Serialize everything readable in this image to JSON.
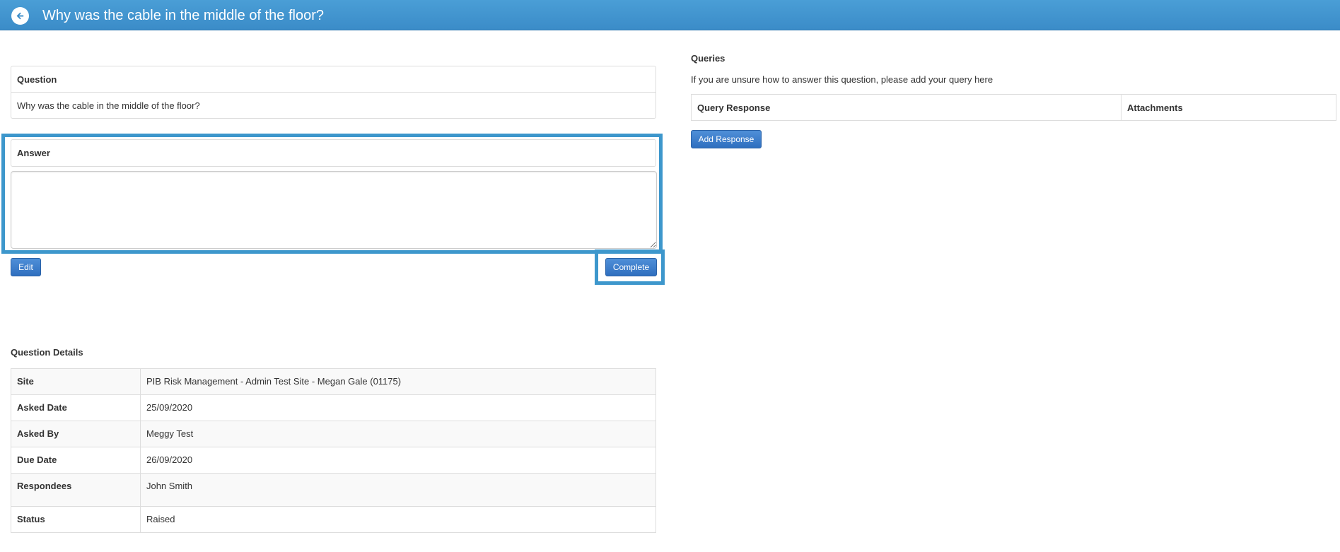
{
  "header": {
    "title": "Why was the cable in the middle of the floor?",
    "back_icon": "arrow-left-circle-icon"
  },
  "question": {
    "heading": "Question",
    "text": "Why was the cable in the middle of the floor?"
  },
  "answer": {
    "heading": "Answer",
    "value": "",
    "placeholder": ""
  },
  "buttons": {
    "edit": "Edit",
    "complete": "Complete",
    "add_response": "Add Response"
  },
  "details": {
    "title": "Question Details",
    "rows": [
      {
        "label": "Site",
        "value": "PIB Risk Management - Admin Test Site - Megan Gale (01175)"
      },
      {
        "label": "Asked Date",
        "value": "25/09/2020"
      },
      {
        "label": "Asked By",
        "value": "Meggy Test"
      },
      {
        "label": "Due Date",
        "value": "26/09/2020"
      },
      {
        "label": "Respondees",
        "value": "John Smith"
      },
      {
        "label": "Status",
        "value": "Raised"
      }
    ]
  },
  "queries": {
    "title": "Queries",
    "description": "If you are unsure how to answer this question, please add your query here",
    "columns": [
      "Query Response",
      "Attachments"
    ]
  },
  "colors": {
    "header": "#3b8cc8",
    "highlight": "#3d97cc",
    "button": "#2f6fbf"
  }
}
